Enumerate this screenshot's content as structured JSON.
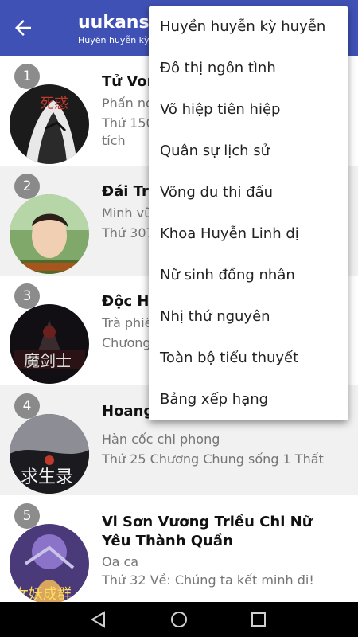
{
  "app": {
    "title": "uukanshu",
    "subtitle": "Huyền huyễn kỳ h"
  },
  "books": [
    {
      "rank": "1",
      "title": "Tử Vor",
      "author": "Phấn nọ",
      "chapter": "Thứ 150",
      "chapter_extra": "tích"
    },
    {
      "rank": "2",
      "title": "Đái Trư",
      "author": "Minh vũ",
      "chapter": "Thứ 307"
    },
    {
      "rank": "3",
      "title": "Độc Hà",
      "author": "Trà phiế",
      "chapter": "Chương"
    },
    {
      "rank": "4",
      "title": "Hoang Dã Cầu Sinh Lục",
      "author": "Hàn cốc chi phong",
      "chapter": "Thứ 25 Chương Chung sống 1 Thất"
    },
    {
      "rank": "5",
      "title": "Vi Sơn Vương Triều Chi Nữ Yêu Thành Quần",
      "author": "Oa ca",
      "chapter": "Thứ 32 Về: Chúng ta kết minh đi!"
    }
  ],
  "covers": {
    "c1": "死惑",
    "c3": "魔剑士",
    "c4": "求生录",
    "c5": "女妖成群"
  },
  "menu": {
    "items": [
      "Huyền huyễn kỳ huyễn",
      "Đô thị ngôn tình",
      "Võ hiệp tiên hiệp",
      "Quân sự lịch sử",
      "Võng du thi đấu",
      "Khoa Huyễn Linh dị",
      "Nữ sinh đồng nhân",
      "Nhị thứ nguyên",
      "Toàn bộ tiểu thuyết",
      "Bảng xếp hạng"
    ]
  },
  "colors": {
    "appbar": "#3f51b5",
    "navbar": "#000000",
    "row_alt": "#f1f1f1"
  },
  "icons": {
    "back": "arrow-left-icon",
    "nav_back": "triangle-back-icon",
    "nav_home": "circle-home-icon",
    "nav_recents": "square-recents-icon"
  }
}
